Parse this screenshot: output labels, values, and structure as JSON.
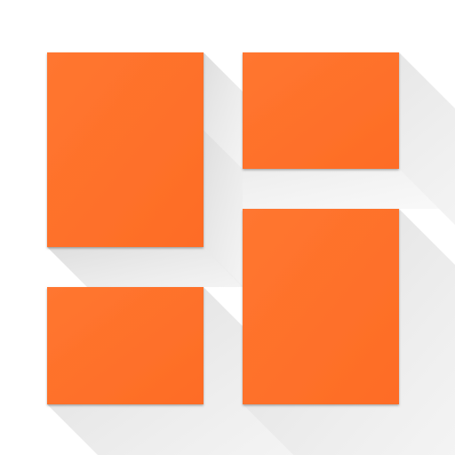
{
  "icon": {
    "name": "dashboard-grid-icon",
    "tile_color": "#fe6c25",
    "tile_color_highlight": "#ff7630",
    "shadow_color": "#e3e3e3",
    "background_color": "#ffffff"
  }
}
